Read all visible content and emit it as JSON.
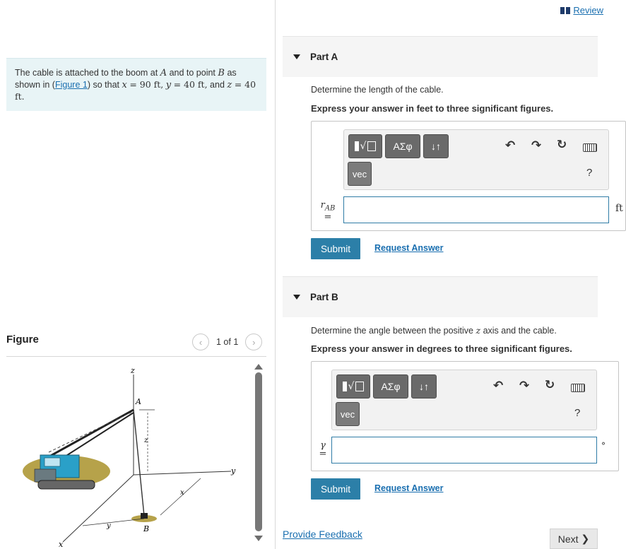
{
  "problem": {
    "text_1": "The cable is attached to the boom at",
    "var_A": "A",
    "text_2": "and to point",
    "var_B": "B",
    "text_3": "as shown in (",
    "figure_link": "Figure 1",
    "text_4": ") so that",
    "x_var": "x",
    "x_val": "= 90 ft,",
    "y_var": "y",
    "y_val": "= 40 ft,",
    "and": "and",
    "z_var": "z",
    "z_val": "= 40 ft."
  },
  "figure": {
    "title": "Figure",
    "count": "1 of 1",
    "labels": {
      "z": "z",
      "A": "A",
      "z_dim": "z",
      "y": "y",
      "x_dim": "x",
      "y_dim": "y",
      "B": "B",
      "x": "x"
    }
  },
  "header": {
    "review_label": "Review"
  },
  "partA": {
    "title": "Part A",
    "question": "Determine the length of the cable.",
    "instruction": "Express your answer in feet to three significant figures.",
    "label_var": "r",
    "label_sub": "AB",
    "label_eq": "=",
    "input_value": "",
    "unit": "ft",
    "submit": "Submit",
    "request": "Request Answer"
  },
  "partB": {
    "title": "Part B",
    "question_1": "Determine the angle between the positive",
    "question_var": "z",
    "question_2": "axis and the cable.",
    "instruction": "Express your answer in degrees to three significant figures.",
    "label_var": "γ",
    "label_eq": "=",
    "input_value": "",
    "unit": "°",
    "submit": "Submit",
    "request": "Request Answer"
  },
  "toolbar": {
    "sigma": "ΑΣφ",
    "arrows": "↓↑",
    "vec": "vec",
    "help": "?"
  },
  "footer": {
    "feedback": "Provide Feedback",
    "next": "Next"
  }
}
